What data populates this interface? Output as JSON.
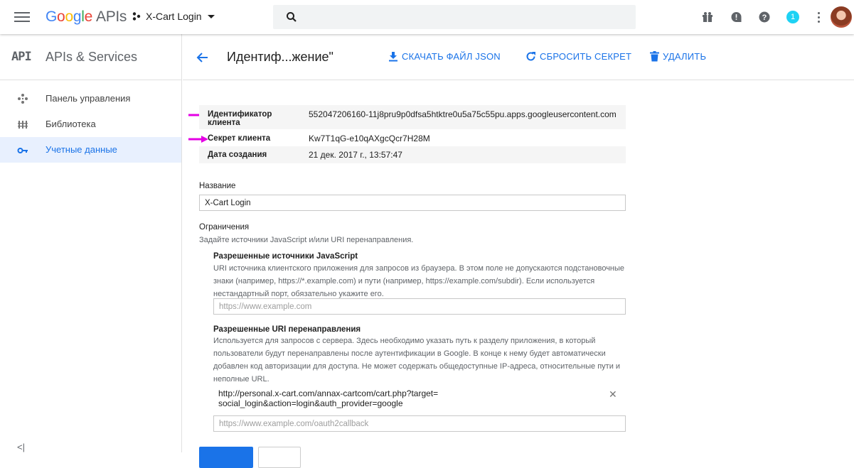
{
  "header": {
    "logo": {
      "g1": "G",
      "g2": "o",
      "g3": "o",
      "g4": "g",
      "g5": "l",
      "g6": "e",
      "suffix": "APIs"
    },
    "project": "X-Cart Login",
    "notification_count": "1"
  },
  "sidebar": {
    "badge": "API",
    "title": "APIs & Services",
    "items": [
      {
        "label": "Панель управления",
        "icon": "dashboard-icon"
      },
      {
        "label": "Библиотека",
        "icon": "library-icon"
      },
      {
        "label": "Учетные данные",
        "icon": "key-icon",
        "active": true
      }
    ],
    "collapse": "<|"
  },
  "page": {
    "title": "Идентиф...жение\"",
    "actions": {
      "download": "СКАЧАТЬ ФАЙЛ JSON",
      "reset": "СБРОСИТЬ СЕКРЕТ",
      "delete": "УДАЛИТЬ"
    }
  },
  "details": {
    "client_id_label": "Идентификатор клиента",
    "client_id": "552047206160-11j8pru9p0dfsa5htktre0u5a75c55pu.apps.googleusercontent.com",
    "secret_label": "Секрет клиента",
    "secret": "Kw7T1qG-e10qAXgcQcr7H28M",
    "created_label": "Дата создания",
    "created": "21 дек. 2017 г., 13:57:47"
  },
  "form": {
    "name_label": "Название",
    "name_value": "X-Cart Login",
    "restrictions_label": "Ограничения",
    "restrictions_desc": "Задайте источники JavaScript и/или URI перенаправления.",
    "js_origins_label": "Разрешенные источники JavaScript",
    "js_origins_desc": "URI источника клиентского приложения для запросов из браузера. В этом поле не допускаются подстановочные знаки (например, https://*.example.com) и пути (например, https://example.com/subdir). Если используется нестандартный порт, обязательно укажите его.",
    "js_origins_placeholder": "https://www.example.com",
    "redirect_label": "Разрешенные URI перенаправления",
    "redirect_desc": "Используется для запросов с сервера. Здесь необходимо указать путь к разделу приложения, в который пользователи будут перенаправлены после аутентификации в Google. В конце к нему будет автоматически добавлен код авторизации для доступа. Не может содержать общедоступные IP-адреса, относительные пути и неполные URL.",
    "redirect_uri": "http://personal.x-cart.com/annax-cartcom/cart.php?target=social_login&action=login&auth_provider=google",
    "redirect_placeholder": "https://www.example.com/oauth2callback"
  },
  "colors": {
    "accent": "#1a73e8",
    "annotation_arrow": "#e400e4"
  }
}
